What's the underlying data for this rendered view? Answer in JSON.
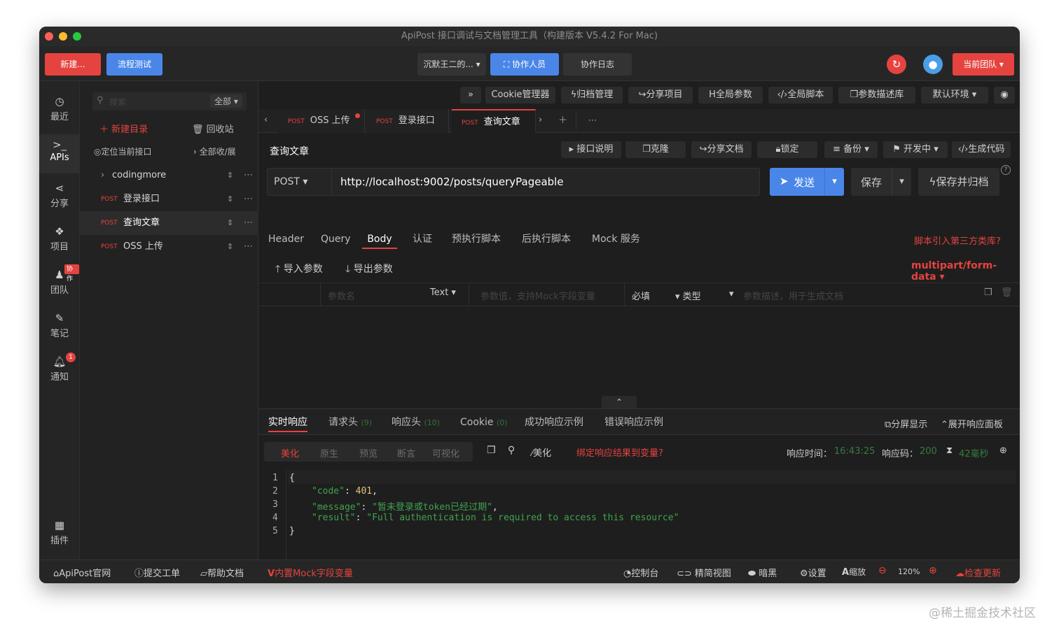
{
  "window": {
    "title": "ApiPost 接口调试与文档管理工具（构建版本 V5.4.2 For Mac)"
  },
  "toolbar": {
    "new_label": "新建...",
    "flow_test_label": "流程测试",
    "project_select": "沉默王二的...",
    "collaborators_label": "协作人员",
    "collab_log_label": "协作日志",
    "current_team_label": "当前团队"
  },
  "leftbar": {
    "recent": "最近",
    "apis": "APIs",
    "share": "分享",
    "project": "项目",
    "team": "团队",
    "team_badge": "协作",
    "notes": "笔记",
    "notify": "通知",
    "notify_count": "1",
    "plugins": "插件"
  },
  "tree": {
    "search_placeholder": "搜索",
    "filter": "全部",
    "new_dir": "新建目录",
    "recycle": "回收站",
    "locate": "定位当前接口",
    "collapse": "全部收/展",
    "items": [
      {
        "tag": "",
        "label": "codingmore",
        "folder": true
      },
      {
        "tag": "POST",
        "label": "登录接口"
      },
      {
        "tag": "POST",
        "label": "查询文章"
      },
      {
        "tag": "POST",
        "label": "OSS 上传"
      }
    ]
  },
  "toolbar2": {
    "cookie_manager": "Cookie管理器",
    "archive_manager": "归档管理",
    "share_project": "分享项目",
    "global_params": "全局参数",
    "global_script": "全局脚本",
    "param_library": "参数描述库",
    "default_env": "默认环境"
  },
  "tabs": [
    {
      "method": "POST",
      "label": "OSS 上传"
    },
    {
      "method": "POST",
      "label": "登录接口"
    },
    {
      "method": "POST",
      "label": "查询文章"
    }
  ],
  "request": {
    "name": "查询文章",
    "doc_label": "接口说明",
    "clone_label": "克隆",
    "share_doc_label": "分享文档",
    "lock_label": "锁定",
    "backup_label": "备份",
    "dev_label": "开发中",
    "gen_code_label": "生成代码",
    "method": "POST",
    "url": "http://localhost:9002/posts/queryPageable",
    "send_label": "发送",
    "save_label": "保存",
    "save_archive_label": "保存并归档"
  },
  "req_tabs": [
    "Header",
    "Query",
    "Body",
    "认证",
    "预执行脚本",
    "后执行脚本",
    "Mock 服务"
  ],
  "third_party_link": "脚本引入第三方类库?",
  "body": {
    "import_label": "导入参数",
    "export_label": "导出参数",
    "content_type": "multipart/form-data",
    "param_name_placeholder": "参数名",
    "param_type": "Text",
    "param_value_placeholder": "参数值，支持Mock字段变量",
    "required_label": "必填",
    "type_label": "类型",
    "desc_placeholder": "参数描述，用于生成文档"
  },
  "response": {
    "tabs": [
      {
        "label": "实时响应",
        "count": ""
      },
      {
        "label": "请求头",
        "count": "(9)"
      },
      {
        "label": "响应头",
        "count": "(10)"
      },
      {
        "label": "Cookie",
        "count": "(0)"
      },
      {
        "label": "成功响应示例",
        "count": ""
      },
      {
        "label": "错误响应示例",
        "count": ""
      }
    ],
    "split_label": "分屏显示",
    "expand_label": "展开响应面板",
    "view_tabs": [
      "美化",
      "原生",
      "预览",
      "断言",
      "可视化"
    ],
    "beautify_label": "美化",
    "bind_label": "绑定响应结果到变量?",
    "time_label": "响应时间：",
    "time_value": "16:43:25",
    "code_label": "响应码：",
    "code_value": "200",
    "duration": "42毫秒",
    "lines": [
      {
        "n": "1",
        "text": "{"
      },
      {
        "n": "2",
        "key": "\"code\"",
        "value": "401",
        "end": ","
      },
      {
        "n": "3",
        "key": "\"message\"",
        "value": "\"暂未登录或token已经过期\"",
        "end": ","
      },
      {
        "n": "4",
        "key": "\"result\"",
        "value": "\"Full authentication is required to access this resource\"",
        "end": ""
      },
      {
        "n": "5",
        "text": "}"
      }
    ]
  },
  "statusbar": {
    "website": "ApiPost官网",
    "ticket": "提交工单",
    "help": "帮助文档",
    "mock": "内置Mock字段变量",
    "console": "控制台",
    "compact": "精简视图",
    "dark": "暗黑",
    "settings": "设置",
    "zoom_label": "缩放",
    "zoom_value": "120%",
    "check_update": "检查更新"
  },
  "watermark": "@稀土掘金技术社区",
  "colors": {
    "accent": "#e5433f",
    "primary": "#4a86e8",
    "bg": "#1e1e1e"
  }
}
